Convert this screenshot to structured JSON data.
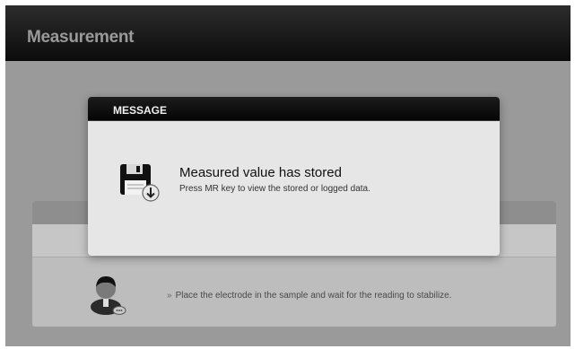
{
  "app": {
    "title": "Measurement"
  },
  "modal": {
    "title": "MESSAGE",
    "message": "Measured value has stored",
    "submessage": "Press MR key to view the stored or logged data.",
    "icon": "save-disk-icon"
  },
  "panel": {
    "hint": "Place the electrode in the sample and wait for the reading to stabilize.",
    "bullet": "»",
    "icon": "user-chat-icon"
  }
}
